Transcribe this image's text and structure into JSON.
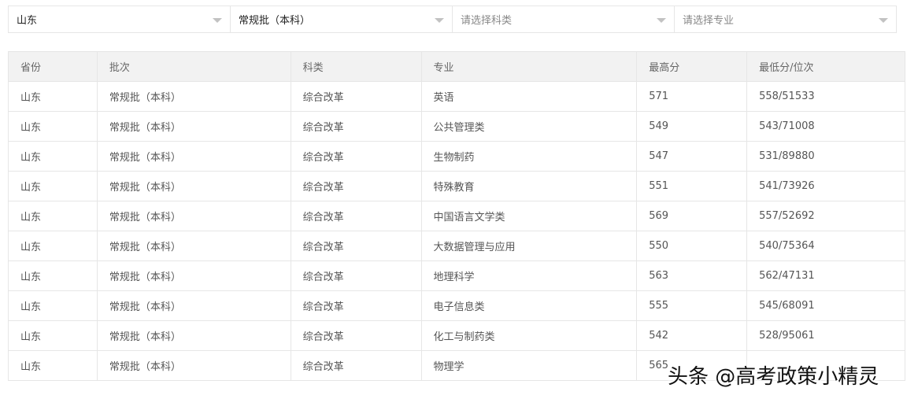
{
  "filters": [
    {
      "value": "山东",
      "placeholder": false
    },
    {
      "value": "常规批（本科）",
      "placeholder": false
    },
    {
      "value": "请选择科类",
      "placeholder": true
    },
    {
      "value": "请选择专业",
      "placeholder": true
    }
  ],
  "table": {
    "headers": [
      "省份",
      "批次",
      "科类",
      "专业",
      "最高分",
      "最低分/位次"
    ],
    "rows": [
      [
        "山东",
        "常规批（本科）",
        "综合改革",
        "英语",
        "571",
        "558/51533"
      ],
      [
        "山东",
        "常规批（本科）",
        "综合改革",
        "公共管理类",
        "549",
        "543/71008"
      ],
      [
        "山东",
        "常规批（本科）",
        "综合改革",
        "生物制药",
        "547",
        "531/89880"
      ],
      [
        "山东",
        "常规批（本科）",
        "综合改革",
        "特殊教育",
        "551",
        "541/73926"
      ],
      [
        "山东",
        "常规批（本科）",
        "综合改革",
        "中国语言文学类",
        "569",
        "557/52692"
      ],
      [
        "山东",
        "常规批（本科）",
        "综合改革",
        "大数据管理与应用",
        "550",
        "540/75364"
      ],
      [
        "山东",
        "常规批（本科）",
        "综合改革",
        "地理科学",
        "563",
        "562/47131"
      ],
      [
        "山东",
        "常规批（本科）",
        "综合改革",
        "电子信息类",
        "555",
        "545/68091"
      ],
      [
        "山东",
        "常规批（本科）",
        "综合改革",
        "化工与制药类",
        "542",
        "528/95061"
      ],
      [
        "山东",
        "常规批（本科）",
        "综合改革",
        "物理学",
        "565",
        ""
      ]
    ]
  },
  "watermark": "头条 @高考政策小精灵"
}
